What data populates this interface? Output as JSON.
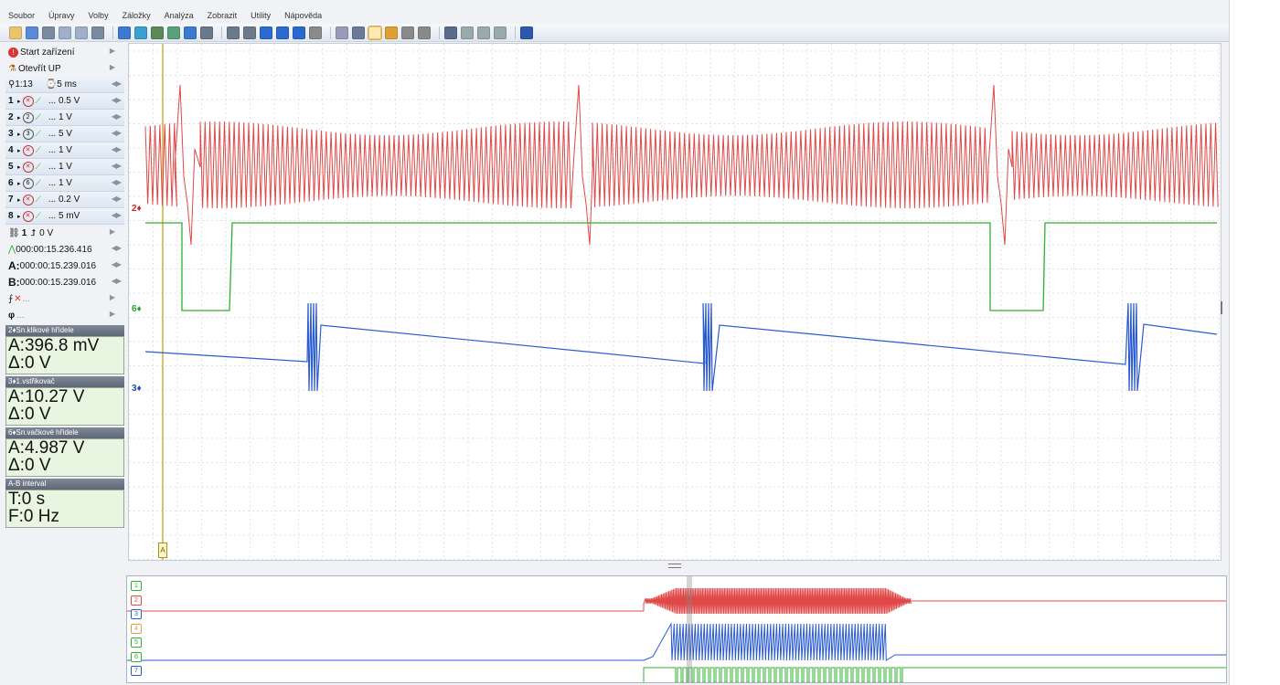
{
  "menu": [
    "Soubor",
    "Úpravy",
    "Volby",
    "Záložky",
    "Analýza",
    "Zobrazit",
    "Utility",
    "Nápověda"
  ],
  "toolbar_icons": [
    "open-icon",
    "save-icon",
    "save-as-icon",
    "copy-icon",
    "paste-icon",
    "print-icon",
    "cursor-icon",
    "marker-icon",
    "channel-icon",
    "measure-icon",
    "filter-icon",
    "undo-icon",
    "zoom-icon",
    "select-icon",
    "check-icon",
    "check-all-icon",
    "check-none-icon",
    "clear-icon",
    "grid-icon",
    "export-icon",
    "autoscale-icon",
    "layout-icon",
    "trigger-icon",
    "trigger-config-icon",
    "channel-list-icon",
    "window-a-icon",
    "window-b-icon",
    "window-c-icon",
    "help-icon"
  ],
  "left_panel": {
    "start_label": "Start zařízení",
    "open_label": "Otevřít UP",
    "zoom_label": "1:13",
    "timebase_label": "5 ms",
    "channels": [
      {
        "num": "1",
        "value": "... 0.5 V",
        "icon": "✕"
      },
      {
        "num": "2",
        "value": "... 1 V",
        "icon": "2"
      },
      {
        "num": "3",
        "value": "... 5 V",
        "icon": "3"
      },
      {
        "num": "4",
        "value": "... 1 V",
        "icon": "✕"
      },
      {
        "num": "5",
        "value": "... 1 V",
        "icon": "✕"
      },
      {
        "num": "6",
        "value": "... 1 V",
        "icon": "6"
      },
      {
        "num": "7",
        "value": "... 0.2 V",
        "icon": "✕"
      },
      {
        "num": "8",
        "value": "... 5 mV",
        "icon": "✕"
      }
    ],
    "trigger_label": "1",
    "trigger_level": "0 V",
    "time_trigger": "000:00:15.236.416",
    "cursor_a": "000:00:15.239.016",
    "cursor_b": "000:00:15.239.016",
    "a_prefix": "A:",
    "b_prefix": "B:",
    "dots": "...",
    "phi_label": "φ"
  },
  "info_boxes": [
    {
      "header": "Sn.klikové hřídele",
      "channel": "2",
      "line1": "A:396.8 mV",
      "line2": "Δ:0 V"
    },
    {
      "header": "1.vstřikovač",
      "channel": "3",
      "line1": "A:10.27 V",
      "line2": "Δ:0 V"
    },
    {
      "header": "Sn.vačkové hřídele",
      "channel": "6",
      "line1": "A:4.987 V",
      "line2": "Δ:0 V"
    },
    {
      "header": "A-B interval",
      "channel": "",
      "line1": "T:0 s",
      "line2": "F:0 Hz"
    }
  ],
  "plot": {
    "channel_labels": [
      {
        "text": "2",
        "color": "#c62828"
      },
      {
        "text": "6",
        "color": "#2e9e2e"
      },
      {
        "text": "3",
        "color": "#1f4fb5"
      }
    ],
    "cursor_label": "A",
    "colors": {
      "red": "#e04848",
      "green": "#2fb02f",
      "blue": "#2b5bd0",
      "cursor": "#c9b23a",
      "grid": "#d6d6d6"
    }
  },
  "overview": {
    "labels": [
      "1",
      "2",
      "3",
      "4",
      "5",
      "6",
      "7"
    ],
    "label_colors": [
      "#2fb02f",
      "#e04848",
      "#2b5bd0",
      "#e0a040",
      "#2fb02f",
      "#2fb02f",
      "#2b5bd0"
    ]
  }
}
